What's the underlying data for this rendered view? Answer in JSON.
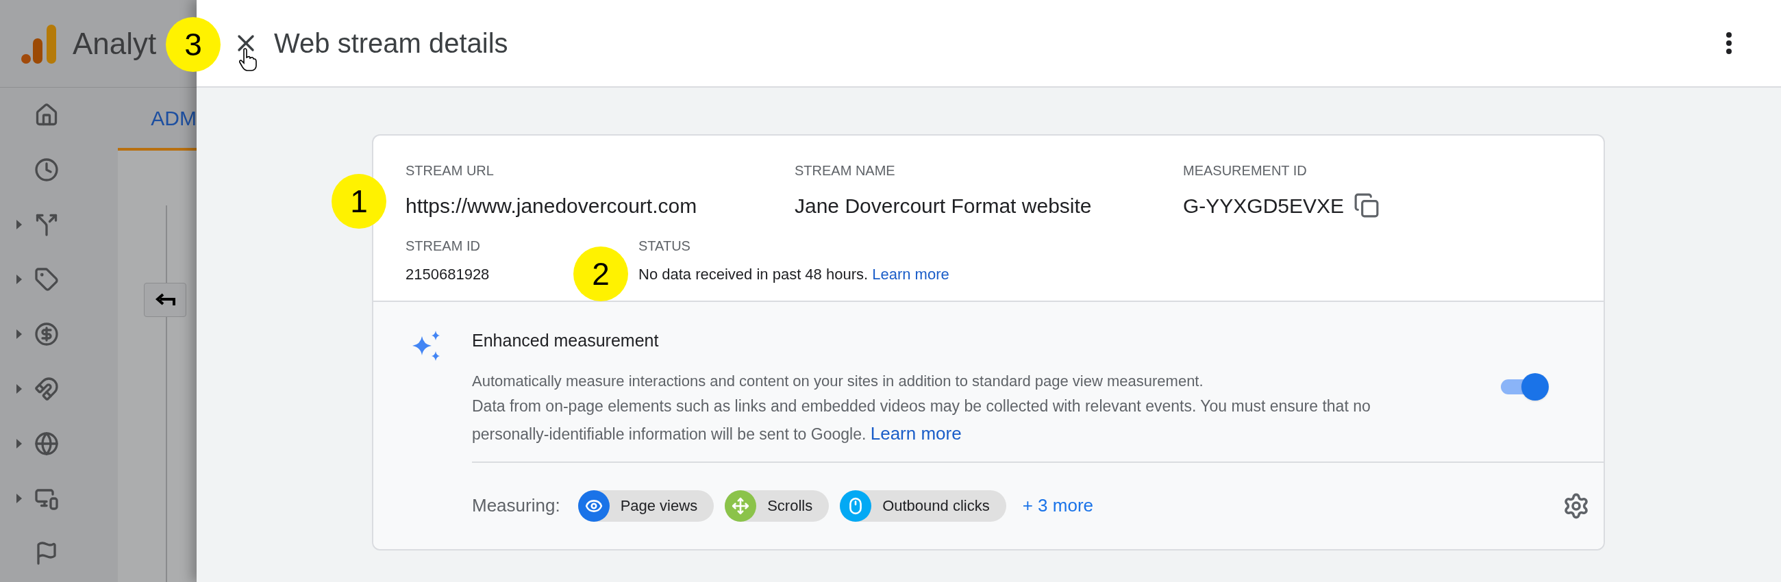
{
  "background": {
    "app_name": "Analyt",
    "tab": {
      "label": "ADM",
      "selected": true
    },
    "nav": [
      {
        "kind": "home",
        "caret": false
      },
      {
        "kind": "clock",
        "caret": false
      },
      {
        "kind": "fork",
        "caret": true
      },
      {
        "kind": "tag",
        "caret": true
      },
      {
        "kind": "dollar",
        "caret": true
      },
      {
        "kind": "magnet",
        "caret": true
      },
      {
        "kind": "globe",
        "caret": true
      },
      {
        "kind": "devices",
        "caret": true
      },
      {
        "kind": "flag",
        "caret": false
      }
    ]
  },
  "panel": {
    "title": "Web stream details",
    "annotation": "3"
  },
  "stream": {
    "fields": [
      {
        "label": "STREAM URL",
        "value": "https://www.janedovercourt.com",
        "annotation": "1",
        "copyable": false
      },
      {
        "label": "STREAM NAME",
        "value": "Jane Dovercourt Format website",
        "copyable": false
      },
      {
        "label": "MEASUREMENT ID",
        "value": "G-YYXGD5EVXE",
        "copyable": true
      }
    ],
    "stream_id": {
      "label": "STREAM ID",
      "value": "2150681928"
    },
    "status": {
      "label": "STATUS",
      "text": "No data received in past 48 hours.",
      "link": "Learn more",
      "annotation": "2"
    }
  },
  "enhanced": {
    "title": "Enhanced measurement",
    "description": "Automatically measure interactions and content on your sites in addition to standard page view measurement.",
    "notice": "Data from on-page elements such as links and embedded videos may be collected with relevant events. You must ensure that no personally-identifiable information will be sent to Google.",
    "link": "Learn more",
    "on": true,
    "measuring_label": "Measuring:",
    "chips": [
      {
        "kind": "eye",
        "label": "Page views",
        "color": "#1a73e8"
      },
      {
        "kind": "scroll",
        "label": "Scrolls",
        "color": "#8bc34a"
      },
      {
        "kind": "mouse",
        "label": "Outbound clicks",
        "color": "#03a9f4"
      }
    ],
    "more": "+ 3 more"
  }
}
